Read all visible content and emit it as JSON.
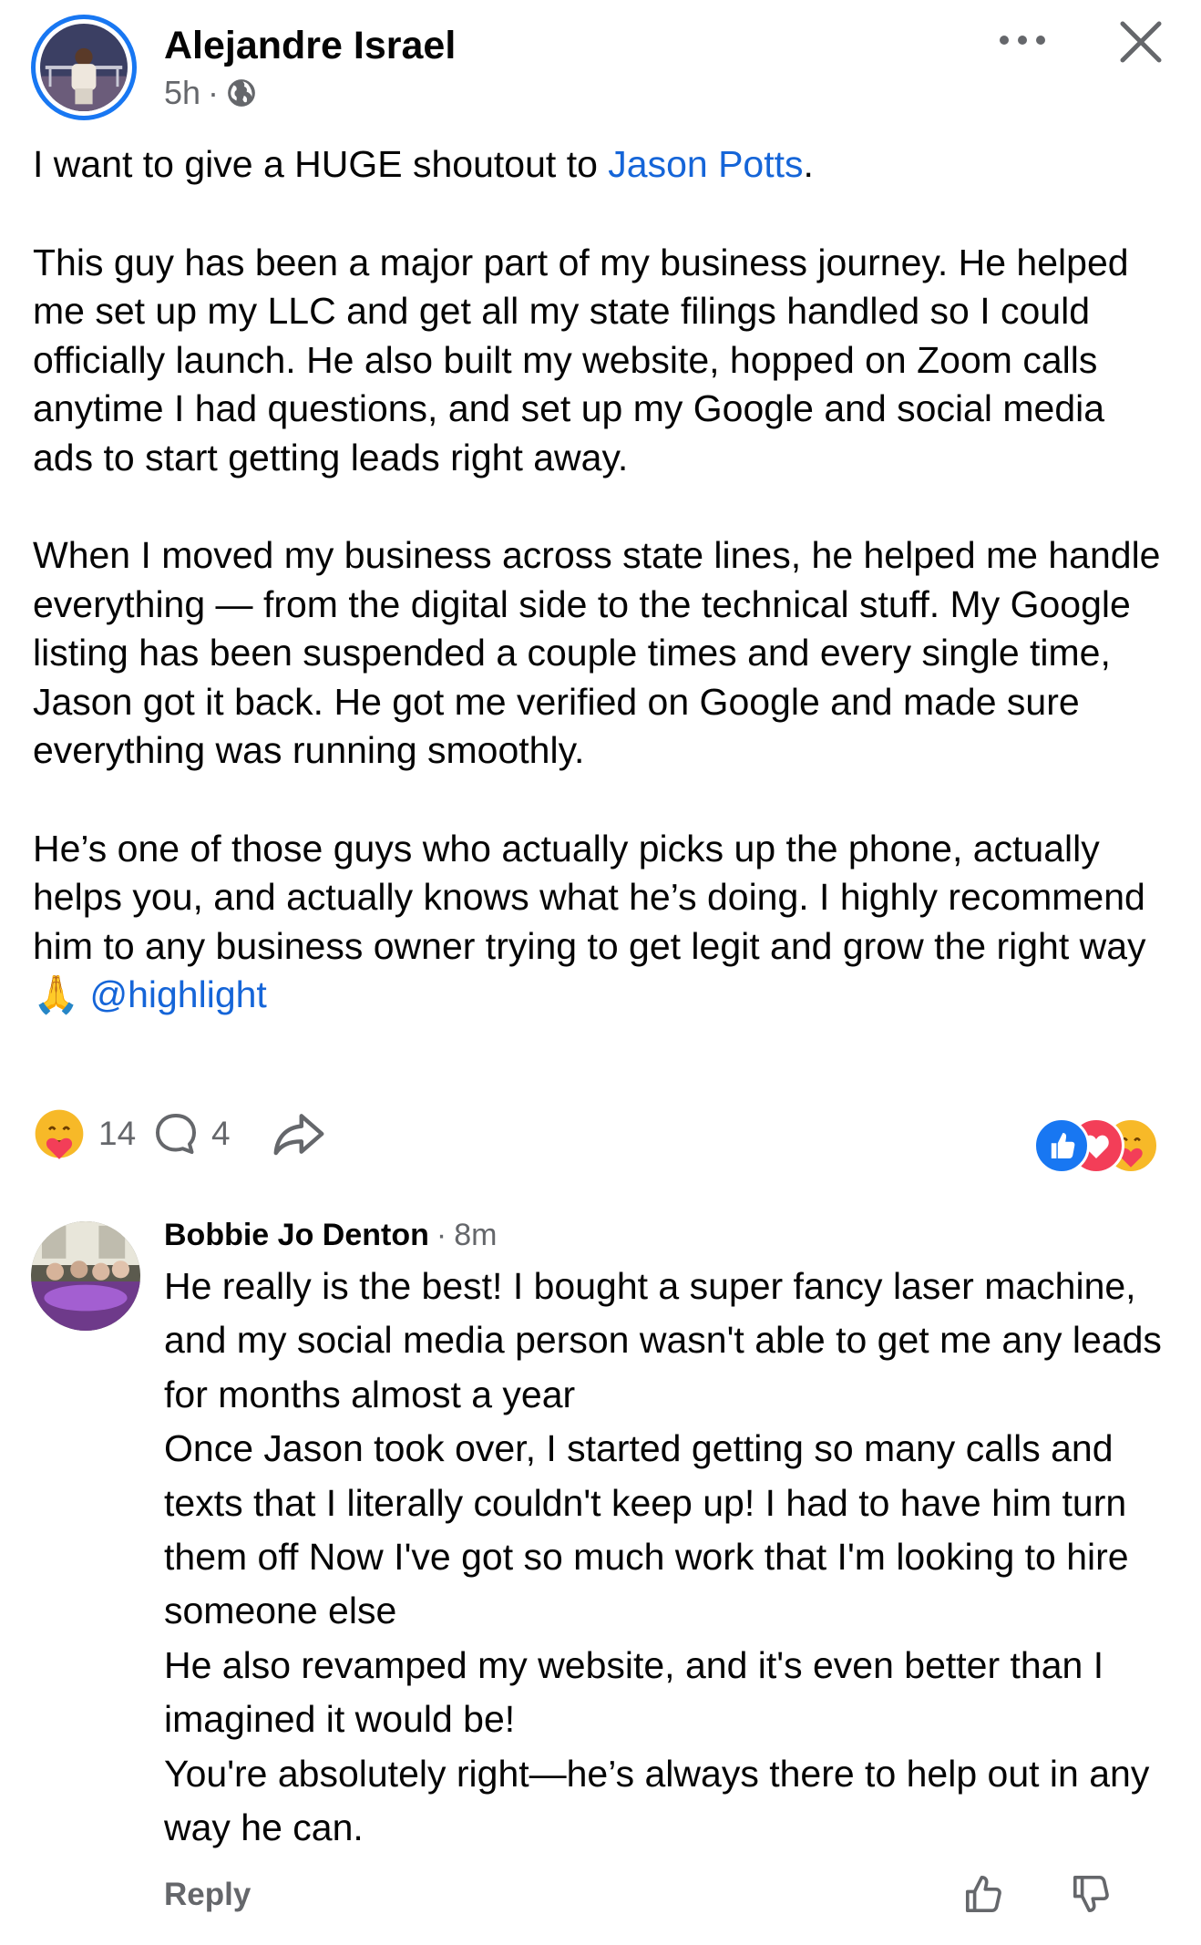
{
  "post": {
    "author": "Alejandre Israel",
    "time": "5h",
    "separator": "·",
    "visibility_icon": "globe-icon",
    "paragraphs": {
      "p1_before": "I want to give a HUGE shoutout to ",
      "p1_mention": "Jason Potts",
      "p1_after": ".",
      "p2": "This guy has been a major part of my business journey. He helped me set up my LLC and get all my state filings handled so I could officially launch. He also built my website, hopped on Zoom calls anytime I had questions, and set up my Google and social media ads to start getting leads right away.",
      "p3": "When I moved my business across state lines, he helped me handle everything — from the digital side to the technical stuff. My Google listing has been suspended a couple times and every single time, Jason got it back. He got me verified on Google and made sure everything was running smoothly.",
      "p4_text": "He’s one of those guys who actually picks up the phone, actually helps you, and actually knows what he’s doing. I highly recommend him to any business owner trying to get legit and grow the right way",
      "p4_emoji": "🙏",
      "p4_tag": "@highlight"
    }
  },
  "actions": {
    "reaction_count": "14",
    "comment_count": "4",
    "react_icon": "care-emoji-icon",
    "comment_icon": "comment-icon",
    "share_icon": "share-icon",
    "reaction_summary": [
      "like-icon",
      "love-icon",
      "care-icon"
    ]
  },
  "comment": {
    "author": "Bobbie Jo Denton",
    "separator": "·",
    "time": "8m",
    "lines": [
      "He really is the best! I bought a super fancy laser machine, and my social media person wasn't able to get me any leads for months almost a year",
      "Once Jason took over, I started getting so many calls and texts that I literally couldn't keep up! I had to have him turn them off Now I've got so much work that I'm looking to hire someone else",
      "He also revamped my website, and it's even better than I imagined it would be!",
      "You're absolutely right—he’s always there to help out in any way he can."
    ],
    "reply_label": "Reply"
  },
  "colors": {
    "link": "#1565d8",
    "secondary_text": "#65676b",
    "avatar_ring": "#1877f2",
    "like_blue": "#1877f2",
    "love_red": "#f33e58",
    "care_yellow": "#f7b928"
  }
}
